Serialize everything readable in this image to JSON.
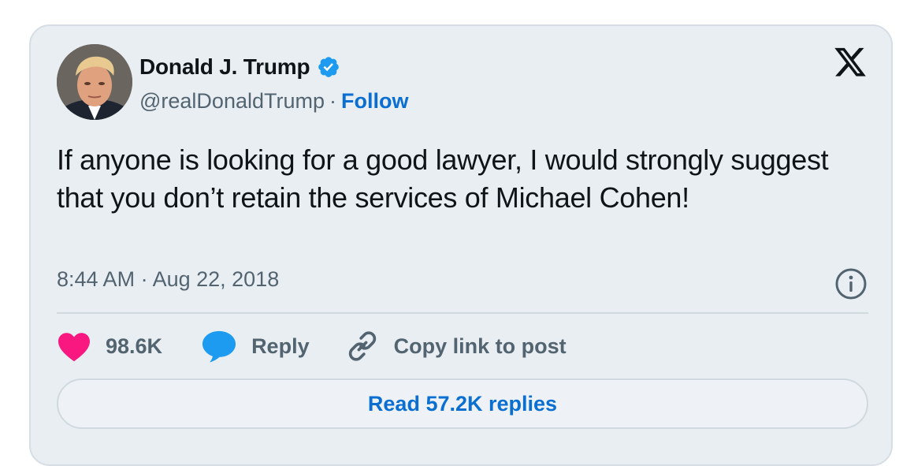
{
  "author": {
    "name": "Donald J. Trump",
    "handle": "@realDonaldTrump",
    "separator": "·",
    "follow_label": "Follow",
    "verified": true,
    "avatar_icon": "avatar-photo"
  },
  "tweet": {
    "text": "If anyone is looking for a good lawyer, I would strongly suggest that you don’t retain the services of Michael Cohen!",
    "timestamp": "8:44 AM · Aug 22, 2018"
  },
  "actions": {
    "like_count": "98.6K",
    "reply_label": "Reply",
    "copy_label": "Copy link to post"
  },
  "read_replies_label": "Read 57.2K replies",
  "icons": {
    "brand": "x-logo-icon",
    "verified": "verified-badge-icon",
    "info": "info-icon",
    "like": "heart-icon",
    "reply": "speech-bubble-icon",
    "copy": "link-icon"
  },
  "colors": {
    "card_background": "#e9eef3",
    "card_border": "#d6dde4",
    "text_primary": "#0f1419",
    "text_secondary": "#536471",
    "link_blue": "#0a6fd1",
    "verified_blue": "#1d9bf0",
    "heart_pink": "#f91880",
    "reply_blue": "#1d9bf0"
  }
}
